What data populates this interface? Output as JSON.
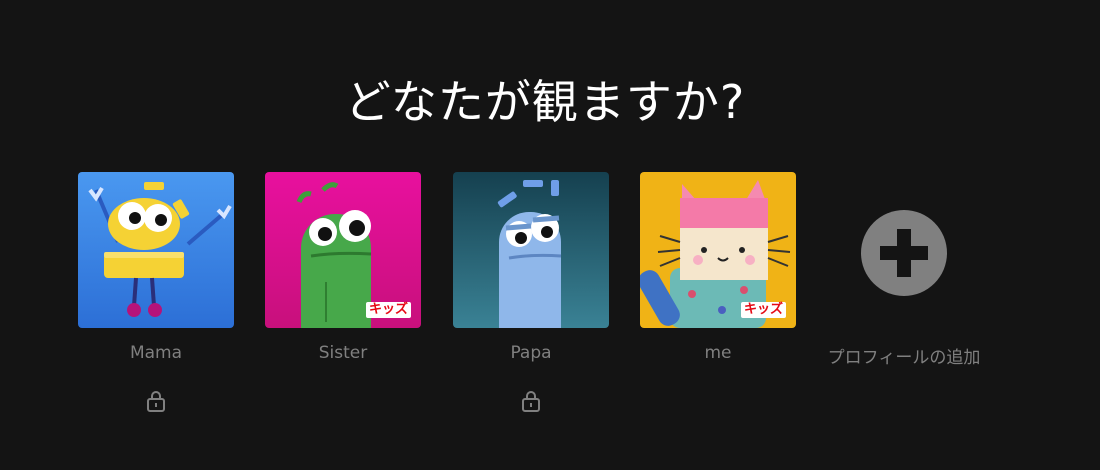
{
  "title": "どなたが観ますか?",
  "profiles": [
    {
      "name": "Mama",
      "locked": true,
      "kids": false,
      "avatar_icon": "yellow-robot-avatar-icon",
      "bg": "#3a86e8"
    },
    {
      "name": "Sister",
      "locked": false,
      "kids": true,
      "kids_label": "キッズ",
      "avatar_icon": "green-robot-avatar-icon",
      "bg": "#e0109a"
    },
    {
      "name": "Papa",
      "locked": true,
      "kids": false,
      "avatar_icon": "blue-robot-avatar-icon",
      "bg": "#1f4f5e"
    },
    {
      "name": "me",
      "locked": false,
      "kids": true,
      "kids_label": "キッズ",
      "avatar_icon": "box-cat-avatar-icon",
      "bg": "#f0b316"
    }
  ],
  "add_profile": {
    "label": "プロフィールの追加",
    "icon": "plus-circle-icon"
  },
  "colors": {
    "background": "#141414",
    "title": "#ffffff",
    "name_text": "#808080",
    "kids_badge": "#e50914",
    "add_circle": "#808080"
  }
}
